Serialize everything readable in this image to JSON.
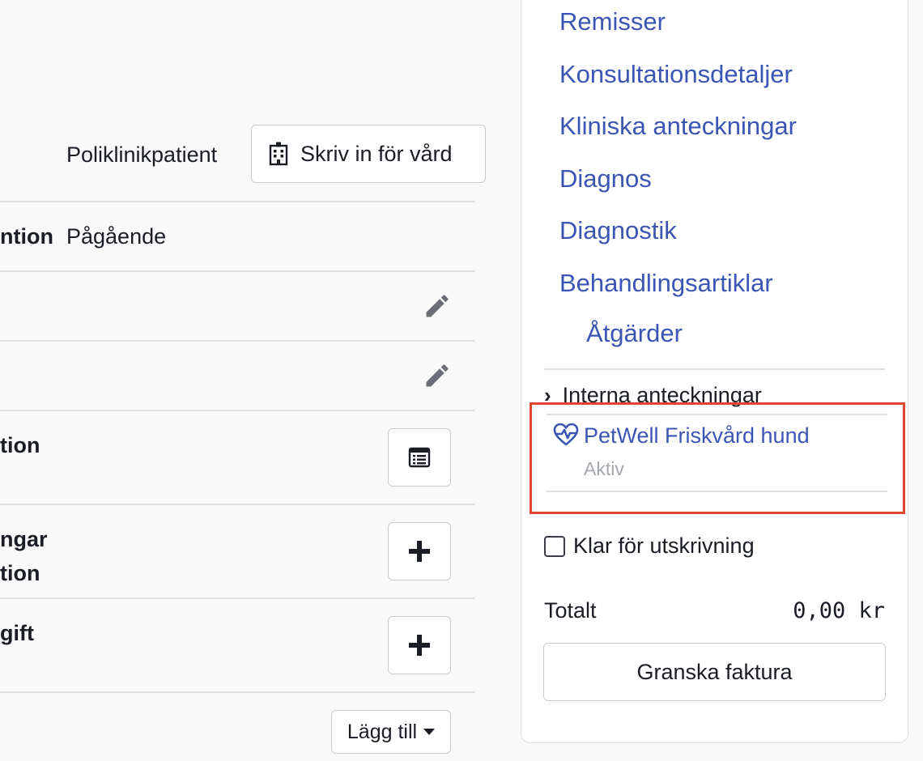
{
  "admission": {
    "patient_type": "Poliklinikpatient",
    "admit_button_label": "Skriv in för vård"
  },
  "consultation": {
    "status_label": "ntion",
    "status_value": "Pågående"
  },
  "sections": {
    "section_a_label": "tion",
    "section_b_line1": "ngar",
    "section_b_line2": "tion",
    "section_c_label": "gift"
  },
  "add_dropdown": {
    "label": "Lägg till"
  },
  "sidebar": {
    "links": [
      {
        "label": "Remisser"
      },
      {
        "label": "Konsultationsdetaljer"
      },
      {
        "label": "Kliniska anteckningar"
      },
      {
        "label": "Diagnos"
      },
      {
        "label": "Diagnostik"
      },
      {
        "label": "Behandlingsartiklar"
      },
      {
        "label": "Åtgärder"
      }
    ],
    "internal_notes_label": "Interna anteckningar",
    "plan": {
      "name": "PetWell Friskvård hund",
      "status": "Aktiv",
      "icon": "heart-pulse-icon"
    },
    "ready_for_discharge_label": "Klar för utskrivning",
    "total_label": "Totalt",
    "total_value": "0,00 kr",
    "review_invoice_label": "Granska faktura"
  },
  "colors": {
    "link": "#3b55b5",
    "highlight": "#e0452f",
    "muted": "#a3a6ad",
    "border": "#c9cbd1"
  }
}
